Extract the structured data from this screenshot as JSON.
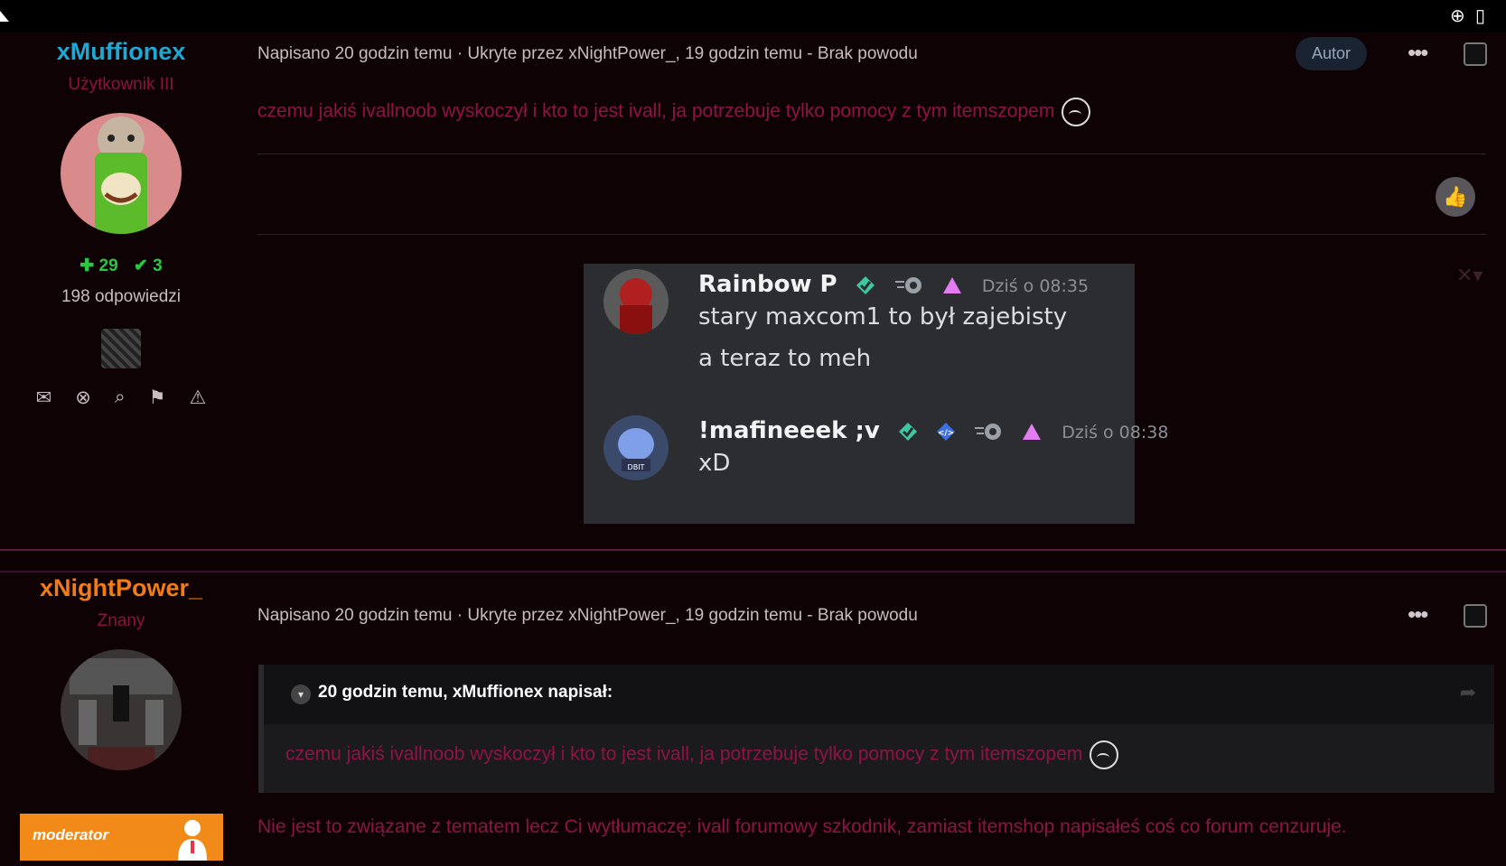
{
  "posts": [
    {
      "author": "xMuffionex",
      "author_color": "#1fa8d4",
      "rank": "Użytkownik III",
      "rep_plus": "29",
      "rep_check": "3",
      "answers": "198 odpowiedzi",
      "meta": "Napisano 20 godzin temu · Ukryte przez xNightPower_, 19 godzin temu - Brak powodu",
      "badge": "Autor",
      "content": "czemu jakiś ivallnoob wyskoczył i kto to jest ivall, ja potrzebuje tylko pomocy z tym itemszopem",
      "embed": {
        "messages": [
          {
            "name": "Rainbow P",
            "time": "Dziś o 08:35",
            "lines": [
              "stary maxcom1 to był zajebisty",
              "a teraz to meh"
            ]
          },
          {
            "name": "!mafineeek ;v",
            "time": "Dziś o 08:38",
            "lines": [
              "xD"
            ],
            "avatar_label": "DBIT"
          }
        ]
      }
    },
    {
      "author": "xNightPower_",
      "author_color": "#f07c18",
      "rank": "Znany",
      "meta": "Napisano 20 godzin temu · Ukryte przez xNightPower_, 19 godzin temu - Brak powodu",
      "quote_head": "20 godzin temu, xMuffionex napisał:",
      "quote_body": "czemu jakiś ivallnoob wyskoczył i kto to jest ivall, ja potrzebuje tylko pomocy z tym itemszopem",
      "content": "Nie jest to związane z tematem lecz Ci wytłumaczę: ivall forumowy szkodnik, zamiast itemshop napisałeś coś co forum cenzuruje.",
      "role_badge": "moderator"
    }
  ],
  "icons": {
    "top_right": [
      "crosshair-icon",
      "vibrate-icon"
    ],
    "actions": [
      "mail-icon",
      "block-icon",
      "search-icon",
      "flag-icon",
      "warning-icon"
    ]
  }
}
